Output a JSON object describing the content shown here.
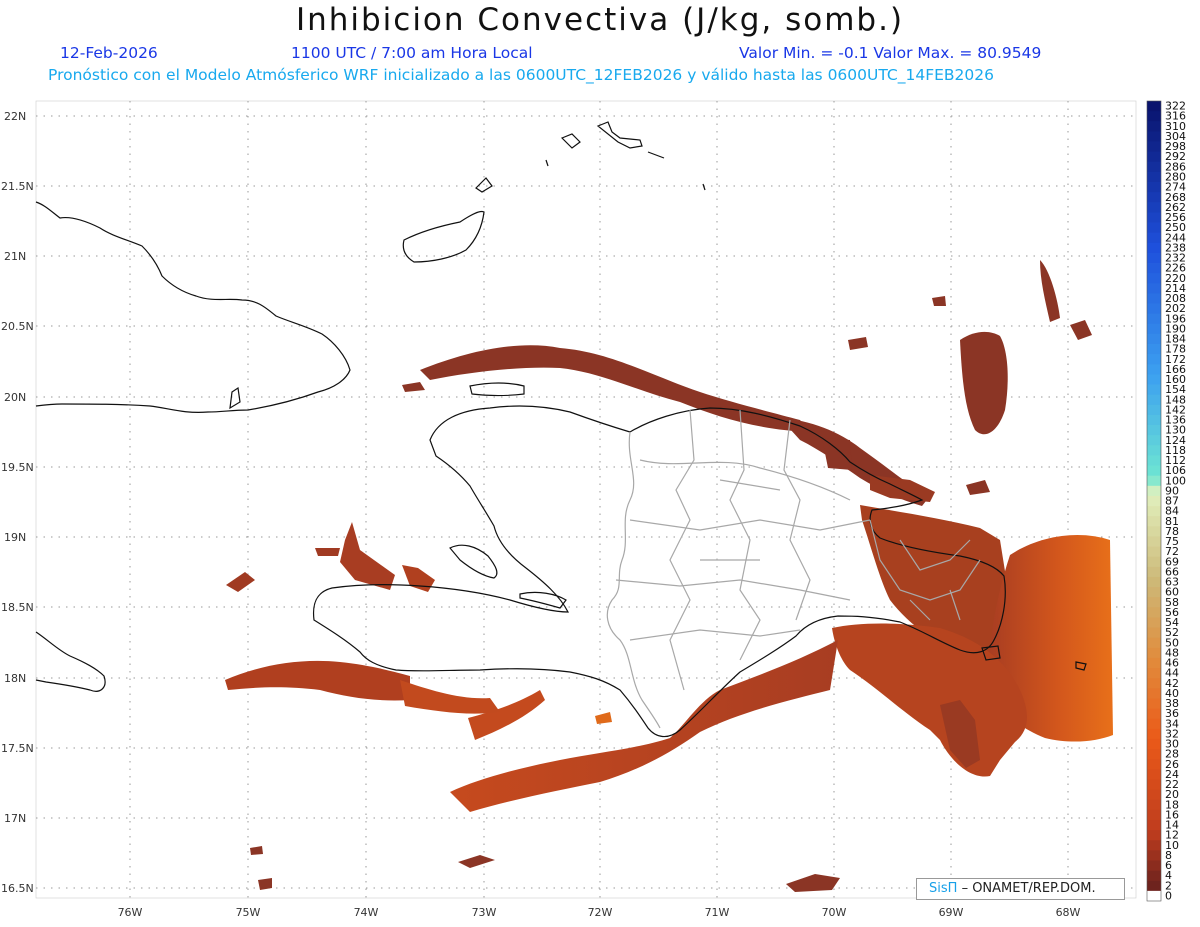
{
  "header": {
    "title": "Inhibicion Convectiva (J/kg, somb.)",
    "date": "12-Feb-2026",
    "time": "1100 UTC / 7:00 am Hora Local",
    "minmax": "Valor Min. = -0.1  Valor Max. = 80.9549",
    "forecast": "Pronóstico con el Modelo Atmósferico WRF inicializado a las 0600UTC_12FEB2026 y válido hasta las  0600UTC_14FEB2026"
  },
  "axes": {
    "lat_labels": [
      "22N",
      "21.5N",
      "21N",
      "20.5N",
      "20N",
      "19.5N",
      "19N",
      "18.5N",
      "18N",
      "17.5N",
      "17N",
      "16.5N"
    ],
    "lon_labels": [
      "76W",
      "75W",
      "74W",
      "73W",
      "72W",
      "71W",
      "70W",
      "69W",
      "68W"
    ]
  },
  "map_data": {
    "variable": "Inhibicion Convectiva",
    "units": "J/kg",
    "value_min": -0.1,
    "value_max": 80.9549,
    "colorbar_levels": [
      322,
      316,
      310,
      304,
      298,
      292,
      286,
      280,
      274,
      268,
      262,
      256,
      250,
      244,
      238,
      232,
      226,
      220,
      214,
      208,
      202,
      196,
      190,
      184,
      178,
      172,
      166,
      160,
      154,
      148,
      142,
      136,
      130,
      124,
      118,
      112,
      106,
      100,
      90,
      87,
      84,
      81,
      78,
      75,
      72,
      69,
      66,
      63,
      60,
      58,
      56,
      54,
      52,
      50,
      48,
      46,
      44,
      42,
      40,
      38,
      36,
      34,
      32,
      30,
      28,
      26,
      24,
      22,
      20,
      18,
      16,
      14,
      12,
      10,
      8,
      6,
      4,
      2,
      0
    ],
    "colors": {
      "low": "#8b3525",
      "mid": "#c84a1f",
      "high": "#e86a1a",
      "coast": "#111111",
      "provinces": "#a8a8a8",
      "grid": "#999999"
    }
  },
  "credit": {
    "brand": "SisΠ",
    "org": "– ONAMET/REP.DOM."
  }
}
